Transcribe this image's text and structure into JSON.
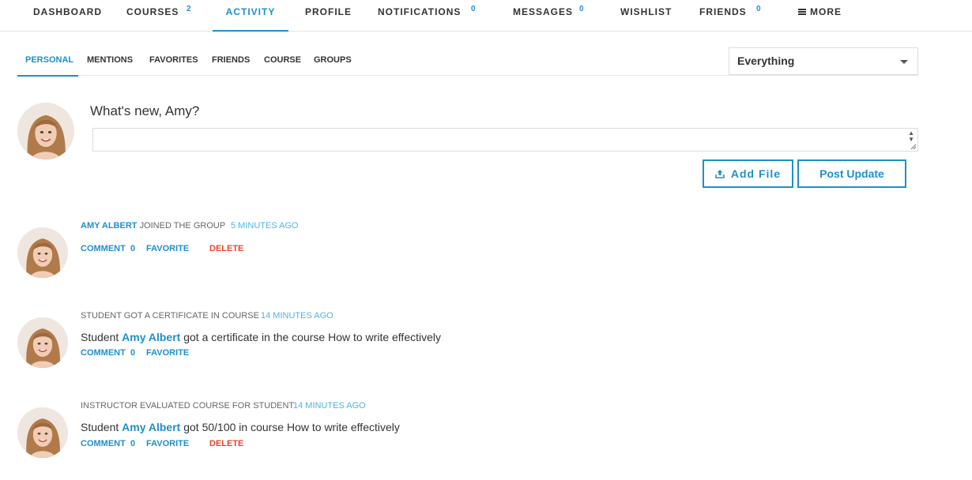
{
  "topnav": {
    "items": [
      {
        "label": "DASHBOARD"
      },
      {
        "label": "COURSES",
        "count": "2"
      },
      {
        "label": "ACTIVITY"
      },
      {
        "label": "PROFILE"
      },
      {
        "label": "NOTIFICATIONS",
        "count": "0"
      },
      {
        "label": "MESSAGES",
        "count": "0"
      },
      {
        "label": "WISHLIST"
      },
      {
        "label": "FRIENDS",
        "count": "0"
      },
      {
        "label": "MORE",
        "icon": "hamburger-icon"
      }
    ],
    "active": "ACTIVITY"
  },
  "subnav": {
    "items": [
      "PERSONAL",
      "MENTIONS",
      "FAVORITES",
      "FRIENDS",
      "COURSE",
      "GROUPS"
    ],
    "active": "PERSONAL"
  },
  "filter": {
    "selected": "Everything"
  },
  "composer": {
    "prompt": "What's new, Amy?",
    "add_file": "Add File",
    "post_update": "Post Update"
  },
  "activity": [
    {
      "who": "AMY ALBERT",
      "action": "JOINED THE GROUP",
      "time": "5 MINUTES AGO",
      "comment": "COMMENT",
      "comment_count": "0",
      "favorite": "FAVORITE",
      "delete": "DELETE"
    },
    {
      "action": "STUDENT GOT A CERTIFICATE IN COURSE",
      "time": "14 MINUTES AGO",
      "body_pre": "Student",
      "body_name": "Amy Albert",
      "body_post": "got a certificate in the course How to write effectively",
      "comment": "COMMENT",
      "comment_count": "0",
      "favorite": "FAVORITE"
    },
    {
      "action": "INSTRUCTOR EVALUATED COURSE FOR STUDENT",
      "time": "14 MINUTES AGO",
      "body_pre": "Student",
      "body_name": "Amy Albert",
      "body_post": "got 50/100 in course How to write effectively",
      "comment": "COMMENT",
      "comment_count": "0",
      "favorite": "FAVORITE",
      "delete": "DELETE"
    }
  ],
  "colors": {
    "accent": "#1f8fc9",
    "time": "#4fb3e0",
    "delete": "#e0482b"
  }
}
